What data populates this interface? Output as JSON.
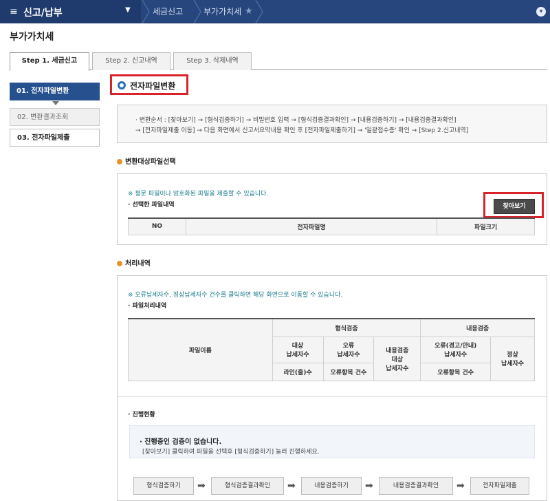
{
  "topbar": {
    "menu_title": "신고/납부",
    "breadcrumb": [
      "세금신고",
      "부가가치세"
    ]
  },
  "page_title": "부가가치세",
  "tabs": [
    {
      "label": "Step 1. 세금신고"
    },
    {
      "label": "Step 2. 신고내역"
    },
    {
      "label": "Step 3. 삭제내역"
    }
  ],
  "sidebar": {
    "items": [
      {
        "label": "01. 전자파일변환"
      },
      {
        "label": "02. 변환결과조회"
      },
      {
        "label": "03. 전자파일제출"
      }
    ]
  },
  "section_title": "전자파일변환",
  "guide": {
    "line1": "· 변환순서 : [찾아보기] → [형식검증하기] → 비밀번호 입력 → [형식검증결과확인] → [내용검증하기] → [내용검증결과확인]",
    "line2": "→ [전자파일제출 이동] → 다음 화면에서 신고서요약내용 확인 후 [전자파일제출하기] → '일괄접수증' 확인 → [Step 2.신고내역]"
  },
  "file_select": {
    "heading": "변환대상파일선택",
    "note": "※ 평문 파일이나 암호화된 파일을 제출할 수 있습니다.",
    "label": "· 선택한 파일내역",
    "browse_button": "찾아보기",
    "columns": [
      "NO",
      "전자파일명",
      "파일크기"
    ]
  },
  "process": {
    "heading": "처리내역",
    "note": "※ 오류납세자수, 정상납세자수 건수를 클릭하면 해당 화면으로 이동할 수 있습니다.",
    "label": "· 파일처리내역",
    "col_filename": "파일이름",
    "group_format": "형식검증",
    "group_content": "내용검증",
    "fmt_target": "대상\n납세자수",
    "fmt_error": "오류\n납세자수",
    "fmt_line": "라인(줄)수",
    "fmt_error_items": "오류항목 건수",
    "content_target": "내용검증\n대상\n납세자수",
    "content_error": "오류(경고/안내)\n납세자수",
    "content_error_items": "오류항목 건수",
    "content_normal": "정상\n납세자수"
  },
  "progress": {
    "label": "· 진행현황",
    "title": "· 진행중인 검증이 없습니다.",
    "desc": "[찾아보기] 클릭하여 파일을 선택후 [형식검증하기] 눌러 진행하세요."
  },
  "flow": [
    "형식검증하기",
    "형식검증결과확인",
    "내용검증하기",
    "내용검증결과확인",
    "전자파일제출"
  ],
  "colors": {
    "topbar": "#27467e",
    "accent_red": "#d9232b",
    "side_active": "#27508f"
  }
}
